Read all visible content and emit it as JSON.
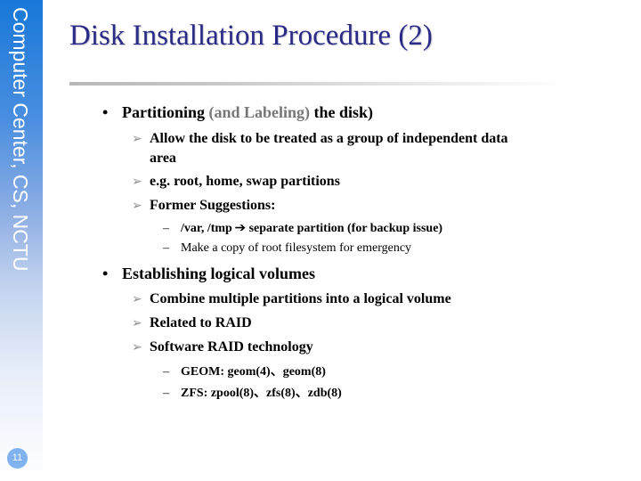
{
  "sidebar": {
    "title": "Computer Center, CS, NCTU",
    "page_number": "11",
    "gradient_top": "#1878d8",
    "gradient_bottom": "#ffffff"
  },
  "slide": {
    "title": "Disk Installation Procedure (2)",
    "title_color": "#2b2b86",
    "bullets": [
      {
        "marker": "•",
        "text_parts": [
          {
            "text": "Partitioning ",
            "style": "normal"
          },
          {
            "text": "(and Labeling)",
            "style": "gray"
          },
          {
            "text": " the disk)",
            "style": "normal"
          }
        ],
        "sub": [
          {
            "marker": "Ø",
            "text": "Allow the disk to be treated as a group of independent data",
            "continuation": "area"
          },
          {
            "marker": "Ø",
            "text": "e.g. root, home, swap partitions"
          },
          {
            "marker": "Ø",
            "text": "Former Suggestions:",
            "sub": [
              {
                "marker": "–",
                "text_before_arrow": "/var, /tmp",
                "arrow": "➔",
                "text_after_arrow": "separate partition (for backup issue)"
              },
              {
                "marker": "–",
                "text": "Make a copy of root filesystem for emergency"
              }
            ]
          }
        ]
      },
      {
        "marker": "•",
        "text": "Establishing logical volumes",
        "sub": [
          {
            "marker": "Ø",
            "text": "Combine multiple partitions into a logical volume"
          },
          {
            "marker": "Ø",
            "text": "Related to RAID"
          },
          {
            "marker": "Ø",
            "text": "Software RAID technology",
            "sub": [
              {
                "marker": "–",
                "text": "GEOM: geom(4)、geom(8)"
              },
              {
                "marker": "–",
                "text": "ZFS: zpool(8)、zfs(8)、zdb(8)"
              }
            ]
          }
        ]
      }
    ]
  },
  "icons": {
    "bullet": "bullet-dot-icon",
    "sub_bullet": "arrowhead-bullet-icon",
    "dash": "dash-bullet-icon",
    "arrow": "right-arrow-icon"
  }
}
